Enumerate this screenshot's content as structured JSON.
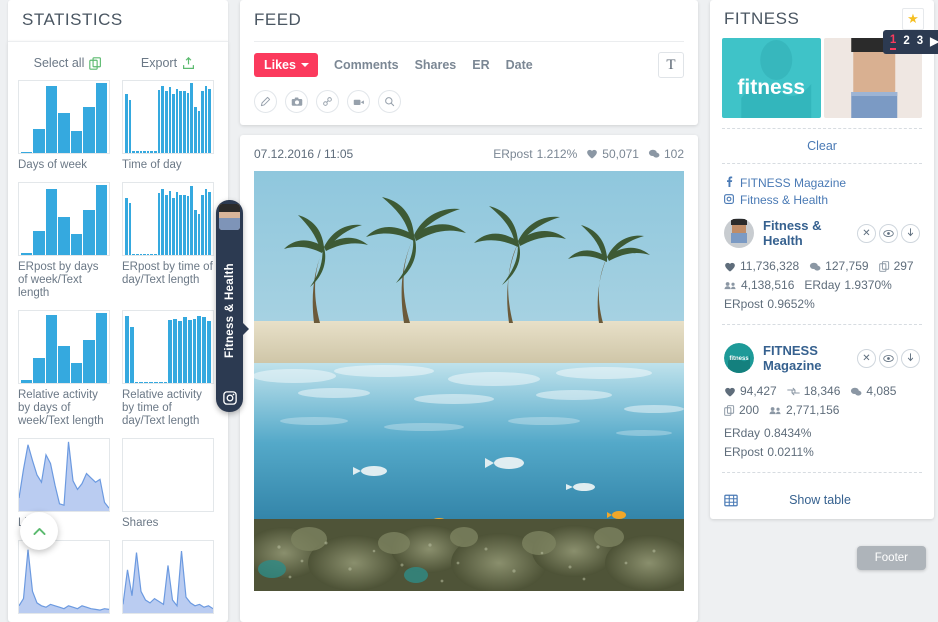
{
  "statistics": {
    "title": "STATISTICS",
    "select_all_label": "Select all",
    "export_label": "Export",
    "thumbs": [
      {
        "label": "Days of week",
        "kind": "bars",
        "values": [
          2,
          34,
          96,
          57,
          31,
          66,
          100
        ]
      },
      {
        "label": "Time of day",
        "kind": "bars",
        "values": [
          84,
          76,
          3,
          3,
          3,
          3,
          3,
          3,
          3,
          90,
          96,
          88,
          94,
          84,
          92,
          88,
          88,
          86,
          100,
          66,
          60,
          88,
          96,
          92
        ]
      },
      {
        "label": "ERpost by days of week/Text length",
        "kind": "bars",
        "values": [
          3,
          35,
          95,
          55,
          30,
          64,
          100
        ]
      },
      {
        "label": "ERpost by time of day/Text length",
        "kind": "bars",
        "values": [
          82,
          74,
          2,
          2,
          2,
          2,
          2,
          2,
          2,
          88,
          95,
          86,
          92,
          82,
          90,
          86,
          86,
          84,
          98,
          64,
          58,
          86,
          94,
          90
        ]
      },
      {
        "label": "Relative activity by days of week/Text length",
        "kind": "bars",
        "values": [
          4,
          36,
          97,
          53,
          28,
          62,
          100
        ]
      },
      {
        "label": "Relative activity by time of day/Text length",
        "kind": "bars",
        "values": [
          96,
          80,
          2,
          2,
          2,
          2,
          2,
          2,
          2,
          90,
          92,
          88,
          94,
          90,
          92,
          96,
          94,
          88
        ]
      },
      {
        "label": "Likes",
        "kind": "area",
        "values": [
          18,
          58,
          92,
          70,
          50,
          40,
          78,
          66,
          36,
          10,
          8,
          96,
          42,
          30,
          38,
          52,
          46,
          40,
          44,
          12,
          4
        ]
      },
      {
        "label": "Shares",
        "kind": "empty",
        "values": []
      },
      {
        "label": "",
        "kind": "area",
        "values": [
          10,
          20,
          88,
          30,
          14,
          10,
          8,
          12,
          10,
          8,
          6,
          10,
          8,
          6,
          10,
          8,
          6,
          5,
          4,
          6,
          5
        ]
      },
      {
        "label": "",
        "kind": "area",
        "values": [
          12,
          60,
          24,
          84,
          30,
          18,
          14,
          20,
          16,
          12,
          66,
          18,
          10,
          86,
          22,
          14,
          10,
          12,
          8,
          10,
          6
        ]
      }
    ],
    "scroll_up_icon": "chevron-up-icon",
    "select_all_icon": "copy-icon",
    "export_icon": "upload-icon"
  },
  "feed": {
    "title": "FEED",
    "sort_active": "Likes",
    "sort_items": [
      "Comments",
      "Shares",
      "ER",
      "Date"
    ],
    "text_toggle_label": "T",
    "filter_icons": [
      "pencil-icon",
      "camera-icon",
      "link-icon",
      "video-icon",
      "search-icon"
    ],
    "post": {
      "date": "07.12.2016 / 11:05",
      "erpost_label": "ERpost",
      "erpost_value": "1.212%",
      "likes": "50,071",
      "comments": "102"
    }
  },
  "side_tab": {
    "label": "Fitness & Health",
    "icon": "instagram-icon"
  },
  "fitness": {
    "title": "FITNESS",
    "star_icon": "star-icon",
    "image_caption": "fitness",
    "pager": {
      "pages": [
        "1",
        "2",
        "3"
      ],
      "active": "1",
      "next_icon": "play-icon"
    },
    "clear_label": "Clear",
    "sources": [
      {
        "icon": "facebook-icon",
        "label": "FITNESS Magazine"
      },
      {
        "icon": "instagram-icon",
        "label": "Fitness & Health"
      }
    ],
    "accounts": [
      {
        "name": "Fitness & Health",
        "avatar": "avatar-fitness-health",
        "buttons": [
          "close-icon",
          "eye-icon",
          "download-icon"
        ],
        "stats": [
          {
            "icon": "heart-icon",
            "value": "11,736,328"
          },
          {
            "icon": "comment-icon",
            "value": "127,759"
          },
          {
            "icon": "copy-icon",
            "value": "297"
          },
          {
            "icon": "users-icon",
            "value": "4,138,516"
          }
        ],
        "erday_label": "ERday",
        "erday_value": "1.9370%",
        "erpost_label": "ERpost",
        "erpost_value": "0.9652%"
      },
      {
        "name": "FITNESS Magazine",
        "avatar": "avatar-fitness-magazine",
        "buttons": [
          "close-icon",
          "eye-icon",
          "download-icon"
        ],
        "stats": [
          {
            "icon": "heart-icon",
            "value": "94,427"
          },
          {
            "icon": "retweet-icon",
            "value": "18,346"
          },
          {
            "icon": "comment-icon",
            "value": "4,085"
          },
          {
            "icon": "copy-icon",
            "value": "200"
          },
          {
            "icon": "users-icon",
            "value": "2,771,156"
          }
        ],
        "erday_label": "ERday",
        "erday_value": "0.8434%",
        "erpost_label": "ERpost",
        "erpost_value": "0.0211%"
      }
    ],
    "show_table_label": "Show table",
    "table_icon": "table-icon"
  },
  "footer": {
    "label": "Footer"
  },
  "colors": {
    "accent_pink": "#fb3a5d",
    "bar_blue": "#35a9df",
    "area_blue": "#aec3ee",
    "green": "#5bba6f",
    "link_blue": "#36618f",
    "dark_navy": "#2c3a51",
    "star_gold": "#f5bf21"
  }
}
